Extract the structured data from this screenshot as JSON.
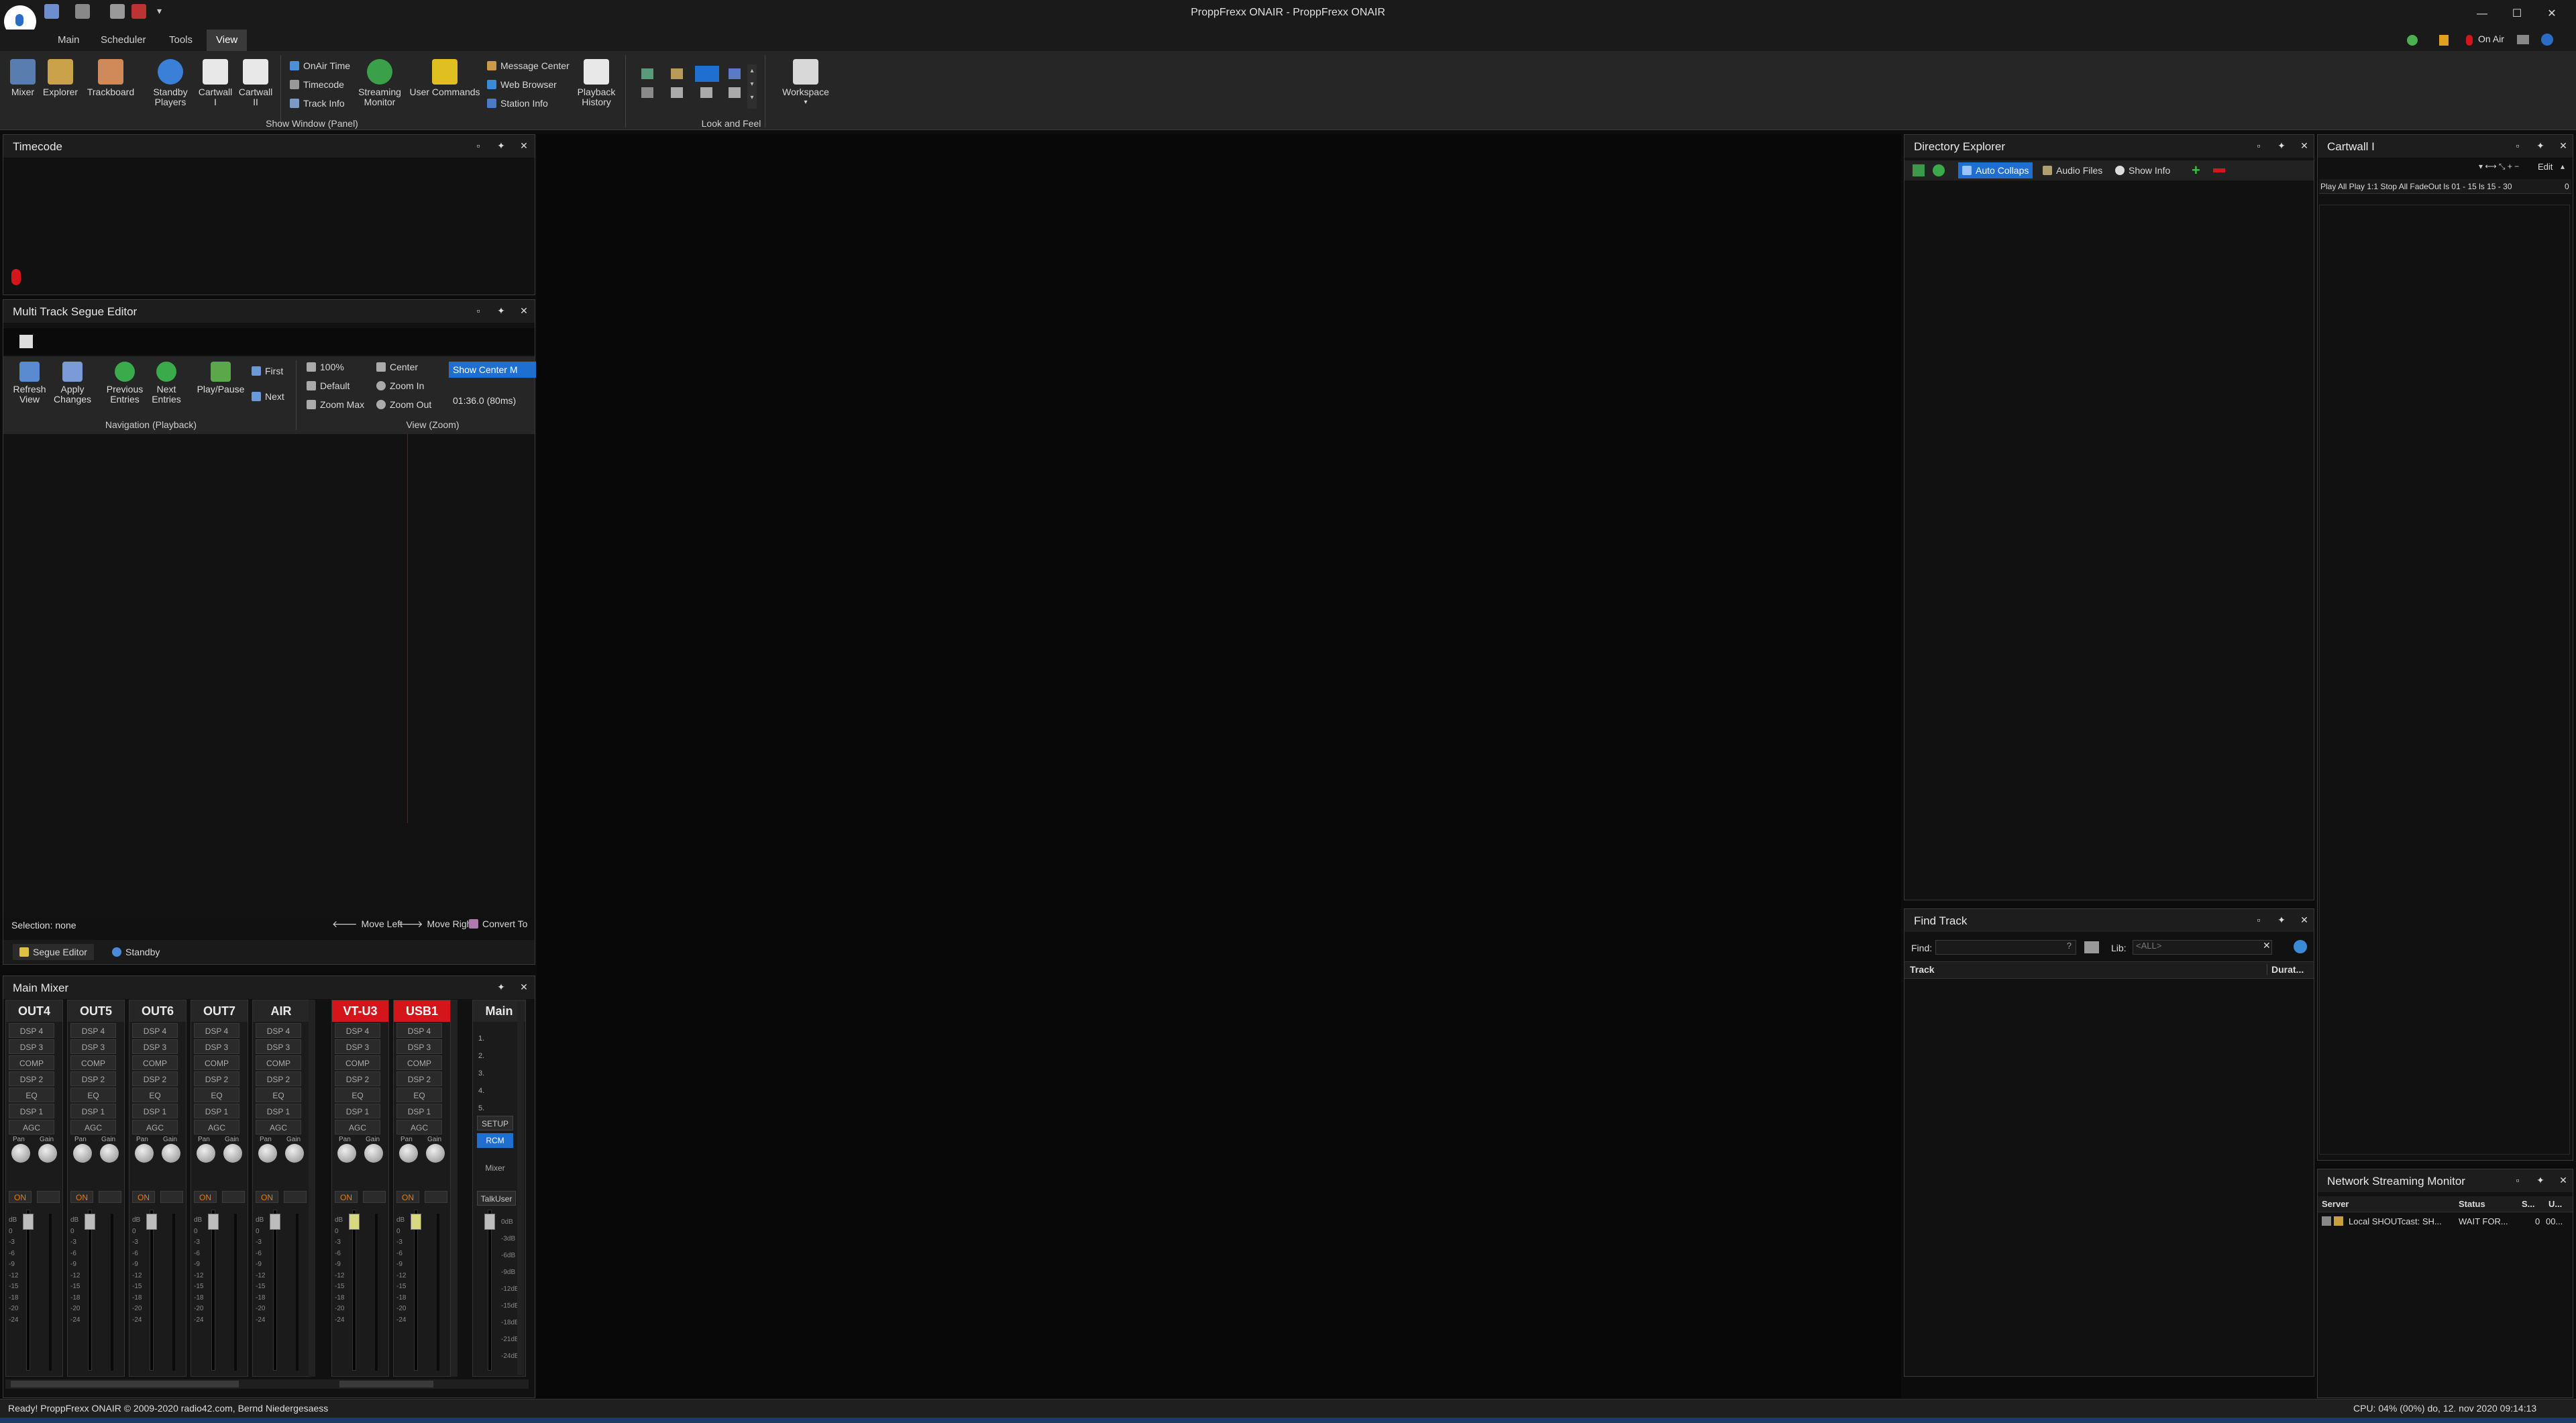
{
  "app": {
    "title": "ProppFrexx ONAIR - ProppFrexx ONAIR",
    "tabs": [
      "Main",
      "Scheduler",
      "Tools",
      "View"
    ],
    "active_tab": "View",
    "status_right_onair": "On Air"
  },
  "ribbon": {
    "big_buttons": [
      {
        "label": "Mixer"
      },
      {
        "label": "Explorer"
      },
      {
        "label": "Trackboard"
      },
      {
        "label": "Standby\nPlayers"
      },
      {
        "label": "Cartwall\nI"
      },
      {
        "label": "Cartwall\nII"
      }
    ],
    "small_col1": [
      "OnAir Time",
      "Timecode",
      "Track Info"
    ],
    "streaming_monitor": "Streaming\nMonitor",
    "user_commands": "User Commands",
    "small_col2": [
      "Message Center",
      "Web Browser",
      "Station Info"
    ],
    "playback_history": "Playback\nHistory",
    "group_show_window": "Show Window (Panel)",
    "group_look_feel": "Look and Feel",
    "workspace": "Workspace"
  },
  "timecode_panel": {
    "title": "Timecode"
  },
  "segue_panel": {
    "title": "Multi Track Segue Editor",
    "tools": {
      "refresh": "Refresh\nView",
      "apply": "Apply\nChanges",
      "previous": "Previous\nEntries",
      "next": "Next\nEntries",
      "playpause": "Play/Pause",
      "first": "First",
      "next_small": "Next",
      "pct100": "100%",
      "default": "Default",
      "zoom_max": "Zoom Max",
      "center": "Center",
      "zoom_in": "Zoom In",
      "zoom_out": "Zoom Out",
      "show_center": "Show Center M",
      "time": "01:36.0 (80ms)"
    },
    "group_nav": "Navigation (Playback)",
    "group_view": "View (Zoom)",
    "selection": "Selection: none",
    "move_left": "Move Left",
    "move_right": "Move Right",
    "convert_to": "Convert To",
    "bottom_tabs": [
      "Segue Editor",
      "Standby"
    ]
  },
  "mixer_panel": {
    "title": "Main Mixer",
    "channels": [
      {
        "name": "OUT4",
        "red": false
      },
      {
        "name": "OUT5",
        "red": false
      },
      {
        "name": "OUT6",
        "red": false
      },
      {
        "name": "OUT7",
        "red": false
      },
      {
        "name": "AIR",
        "red": false
      },
      {
        "name": "VT-U3",
        "red": true
      },
      {
        "name": "USB1",
        "red": true
      }
    ],
    "dsp_rows": [
      "DSP 4",
      "DSP 3",
      "COMP",
      "DSP 2",
      "EQ",
      "DSP 1",
      "AGC"
    ],
    "knob_labels": [
      "Pan",
      "Gain"
    ],
    "on_label": "ON",
    "scale": [
      "dB",
      "0",
      "-3",
      "-6",
      "-9",
      "-12",
      "-15",
      "-18",
      "-20",
      "-24"
    ],
    "main": {
      "name": "Main",
      "slots": [
        "1.",
        "2.",
        "3.",
        "4.",
        "5."
      ],
      "setup": "SETUP",
      "rcm": "RCM",
      "mixer": "Mixer",
      "talkuser": "TalkUser",
      "scale": [
        "0dB",
        "-3dB",
        "-6dB",
        "-9dB",
        "-12dB",
        "-15dB",
        "-18dB",
        "-21dB",
        "-24dB"
      ]
    }
  },
  "directory_panel": {
    "title": "Directory Explorer",
    "toolbar": [
      "Auto Collaps",
      "Audio Files",
      "Show Info"
    ]
  },
  "find_panel": {
    "title": "Find Track",
    "find_label": "Find:",
    "lib_label": "Lib:",
    "lib_value": "<ALL>",
    "columns": [
      "Track",
      "Durat..."
    ]
  },
  "cartwall_panel": {
    "title": "Cartwall I",
    "edit": "Edit",
    "toolbar_text": "Play All  Play 1:1  Stop All  FadeOut  ls 01 - 15  ls 15 - 30",
    "count": "0"
  },
  "nsm_panel": {
    "title": "Network Streaming Monitor",
    "columns": [
      "Server",
      "Status",
      "S...",
      "U..."
    ],
    "rows": [
      {
        "server": "Local SHOUTcast: SH...",
        "status": "WAIT FOR...",
        "s": "0",
        "u": "00..."
      }
    ]
  },
  "statusbar": {
    "left": "Ready!  ProppFrexx ONAIR © 2009-2020 radio42.com, Bernd Niedergesaess",
    "right": "CPU: 04% (00%)    do, 12. nov 2020 09:14:13"
  },
  "colors": {
    "accent": "#1f6fd1",
    "red": "#d4161b",
    "orange": "#e27a1a"
  }
}
